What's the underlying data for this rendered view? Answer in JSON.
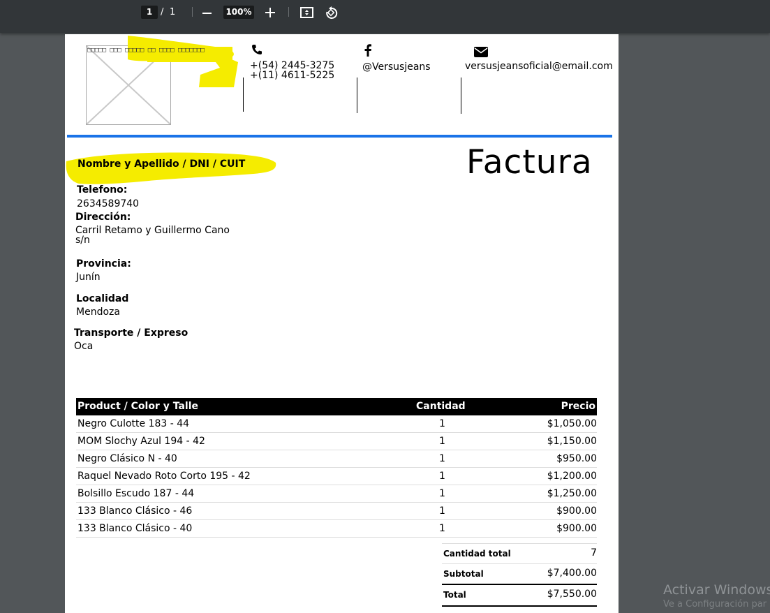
{
  "toolbar": {
    "page_current": "1",
    "page_separator": "/",
    "page_total": "1",
    "zoom": "100%"
  },
  "header": {
    "logo_alt": "□□□□□ □□□ □□□□□ □□ □□□□ □□□□□□□",
    "phone_1": "+(54) 2445-3275",
    "phone_2": "+(11) 4611-5225",
    "facebook": "@Versusjeans",
    "email": "versusjeansoficial@email.com"
  },
  "customer": {
    "name_label": "Nombre y Apellido / DNI / CUIT",
    "phone_label": "Telefono:",
    "phone_value": "2634589740",
    "address_label": "Dirección:",
    "address_line1": "Carril Retamo y Guillermo Cano",
    "address_line2": "s/n",
    "province_label": "Provincia:",
    "province_value": "Junín",
    "locality_label": "Localidad",
    "locality_value": "Mendoza",
    "transport_label": "Transporte / Expreso",
    "transport_value": "Oca"
  },
  "invoice_title": "Factura",
  "table": {
    "headers": [
      "Product / Color y Talle",
      "Cantidad",
      "Precio"
    ],
    "rows": [
      [
        "Negro Culotte 183 - 44",
        "1",
        "$1,050.00"
      ],
      [
        "MOM Slochy Azul 194 - 42",
        "1",
        "$1,150.00"
      ],
      [
        "Negro Clásico N - 40",
        "1",
        "$950.00"
      ],
      [
        "Raquel Nevado Roto Corto 195 - 42",
        "1",
        "$1,200.00"
      ],
      [
        "Bolsillo Escudo 187 - 44",
        "1",
        "$1,250.00"
      ],
      [
        "133 Blanco Clásico - 46",
        "1",
        "$900.00"
      ],
      [
        "133 Blanco Clásico - 40",
        "1",
        "$900.00"
      ]
    ]
  },
  "totals": {
    "qty_label": "Cantidad total",
    "qty_value": "7",
    "subtotal_label": "Subtotal",
    "subtotal_value": "$7,400.00",
    "total_label": "Total",
    "total_value": "$7,550.00"
  },
  "watermark": {
    "line1": "Activar Windows",
    "line2": "Ve a Configuración par"
  },
  "colors": {
    "toolbar_bg": "#323639",
    "viewer_bg": "#525659",
    "accent_rule": "#1a73e8",
    "highlight": "#f5ec00"
  }
}
